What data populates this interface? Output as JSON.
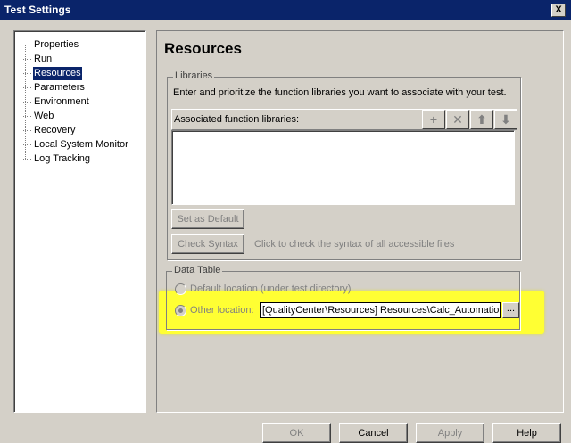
{
  "window": {
    "title": "Test Settings",
    "close_glyph": "X"
  },
  "tree": {
    "items": [
      {
        "label": "Properties",
        "selected": false
      },
      {
        "label": "Run",
        "selected": false
      },
      {
        "label": "Resources",
        "selected": true
      },
      {
        "label": "Parameters",
        "selected": false
      },
      {
        "label": "Environment",
        "selected": false
      },
      {
        "label": "Web",
        "selected": false
      },
      {
        "label": "Recovery",
        "selected": false
      },
      {
        "label": "Local System Monitor",
        "selected": false
      },
      {
        "label": "Log Tracking",
        "selected": false
      }
    ]
  },
  "panel": {
    "title": "Resources",
    "libraries": {
      "legend": "Libraries",
      "description": "Enter and prioritize the function libraries you want to associate with your test.",
      "list_label": "Associated function libraries:",
      "toolbar": {
        "add": "+",
        "remove": "✕",
        "up": "⬆",
        "down": "⬇"
      },
      "set_default_label": "Set as Default",
      "check_syntax_label": "Check Syntax",
      "check_syntax_hint": "Click to check the syntax of all accessible files"
    },
    "data_table": {
      "legend": "Data Table",
      "default_option": "Default location (under test directory)",
      "other_option": "Other location:",
      "other_path": "[QualityCenter\\Resources] Resources\\Calc_Automation'",
      "browse_label": "..."
    }
  },
  "footer": {
    "ok": "OK",
    "cancel": "Cancel",
    "apply": "Apply",
    "help": "Help"
  },
  "colors": {
    "highlight": "#ffff33",
    "title_bar": "#0a246a",
    "face": "#d4d0c8"
  }
}
